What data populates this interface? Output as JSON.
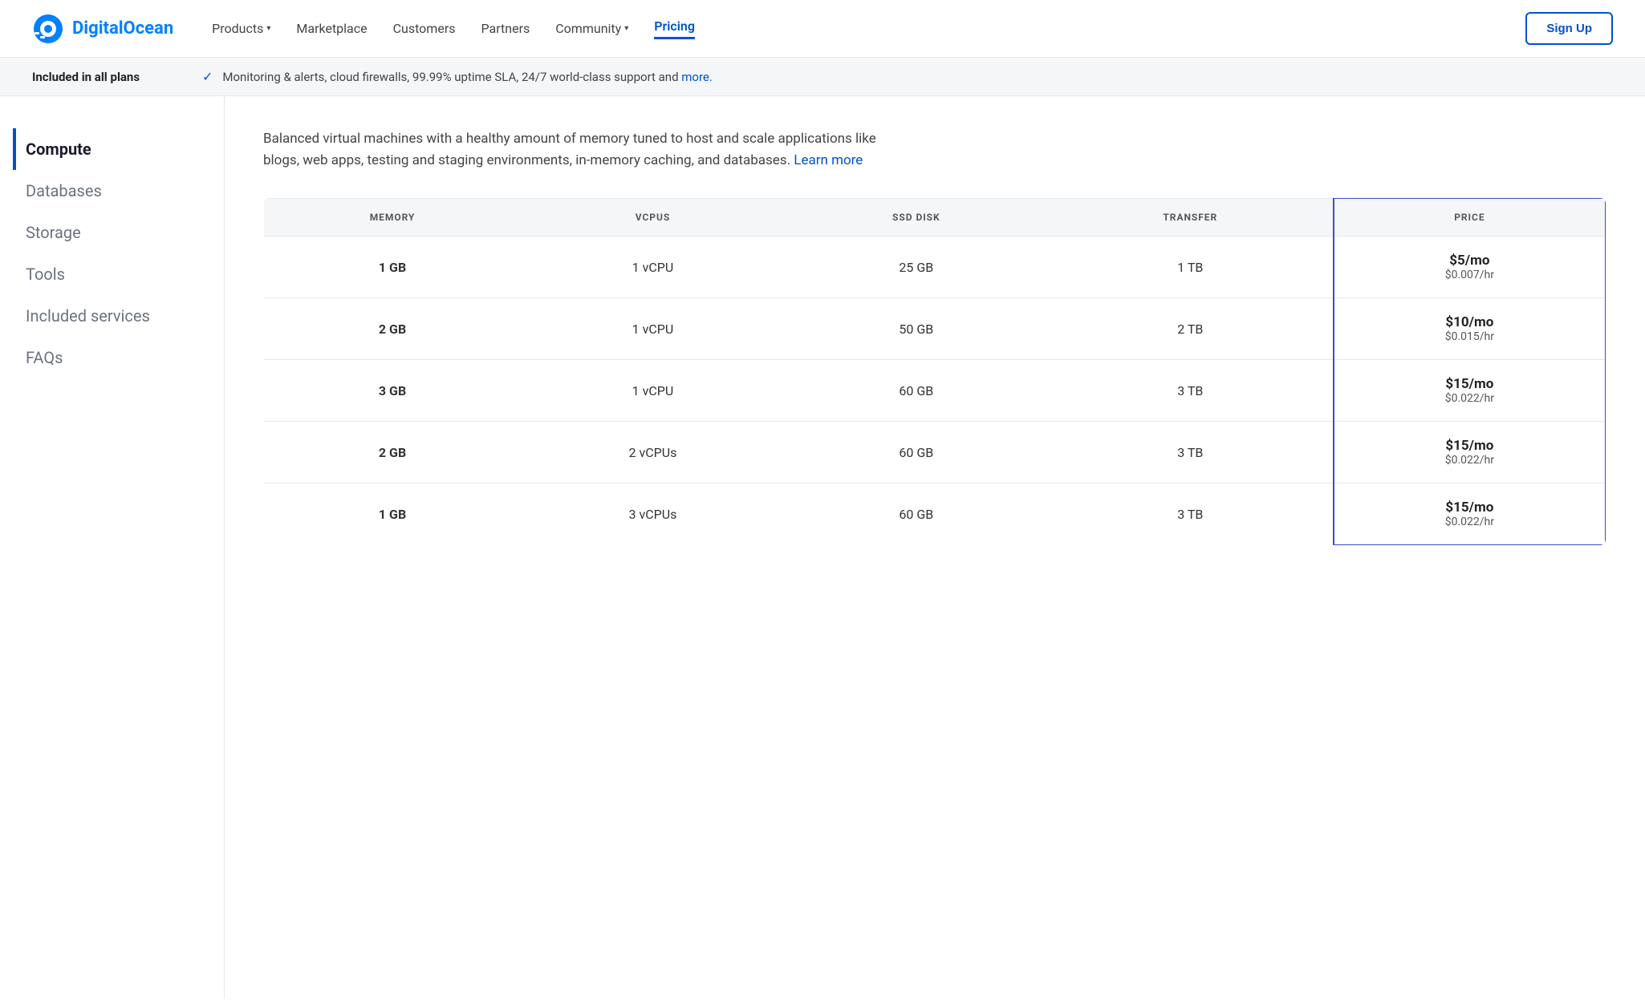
{
  "brand": {
    "name": "DigitalOcean",
    "logo_alt": "DigitalOcean logo"
  },
  "nav": {
    "links": [
      {
        "label": "Products",
        "has_chevron": true,
        "active": false
      },
      {
        "label": "Marketplace",
        "has_chevron": false,
        "active": false
      },
      {
        "label": "Customers",
        "has_chevron": false,
        "active": false
      },
      {
        "label": "Partners",
        "has_chevron": false,
        "active": false
      },
      {
        "label": "Community",
        "has_chevron": true,
        "active": false
      },
      {
        "label": "Pricing",
        "has_chevron": false,
        "active": true
      }
    ],
    "signup_label": "Sign Up"
  },
  "banner": {
    "left": "Included in all plans",
    "check": "✓",
    "text": "Monitoring & alerts, cloud firewalls, 99.99% uptime SLA, 24/7 world-class support and ",
    "link_label": "more.",
    "link_href": "#"
  },
  "sidebar": {
    "items": [
      {
        "label": "Compute",
        "active": true
      },
      {
        "label": "Databases",
        "active": false
      },
      {
        "label": "Storage",
        "active": false
      },
      {
        "label": "Tools",
        "active": false
      },
      {
        "label": "Included services",
        "active": false
      },
      {
        "label": "FAQs",
        "active": false
      }
    ]
  },
  "content": {
    "description": "Balanced virtual machines with a healthy amount of memory tuned to host and scale applications like blogs, web apps, testing and staging environments, in-memory caching, and databases.",
    "learn_more_label": "Learn more",
    "learn_more_href": "#",
    "table": {
      "headers": [
        "MEMORY",
        "VCPUS",
        "SSD DISK",
        "TRANSFER",
        "PRICE"
      ],
      "rows": [
        {
          "memory": "1 GB",
          "vcpus": "1 vCPU",
          "ssd": "25 GB",
          "transfer": "1 TB",
          "price_mo": "$5/mo",
          "price_hr": "$0.007/hr"
        },
        {
          "memory": "2 GB",
          "vcpus": "1 vCPU",
          "ssd": "50 GB",
          "transfer": "2 TB",
          "price_mo": "$10/mo",
          "price_hr": "$0.015/hr"
        },
        {
          "memory": "3 GB",
          "vcpus": "1 vCPU",
          "ssd": "60 GB",
          "transfer": "3 TB",
          "price_mo": "$15/mo",
          "price_hr": "$0.022/hr"
        },
        {
          "memory": "2 GB",
          "vcpus": "2 vCPUs",
          "ssd": "60 GB",
          "transfer": "3 TB",
          "price_mo": "$15/mo",
          "price_hr": "$0.022/hr"
        },
        {
          "memory": "1 GB",
          "vcpus": "3 vCPUs",
          "ssd": "60 GB",
          "transfer": "3 TB",
          "price_mo": "$15/mo",
          "price_hr": "$0.022/hr"
        }
      ]
    }
  },
  "colors": {
    "accent": "#0052cc",
    "price_border": "#3b4cca"
  }
}
